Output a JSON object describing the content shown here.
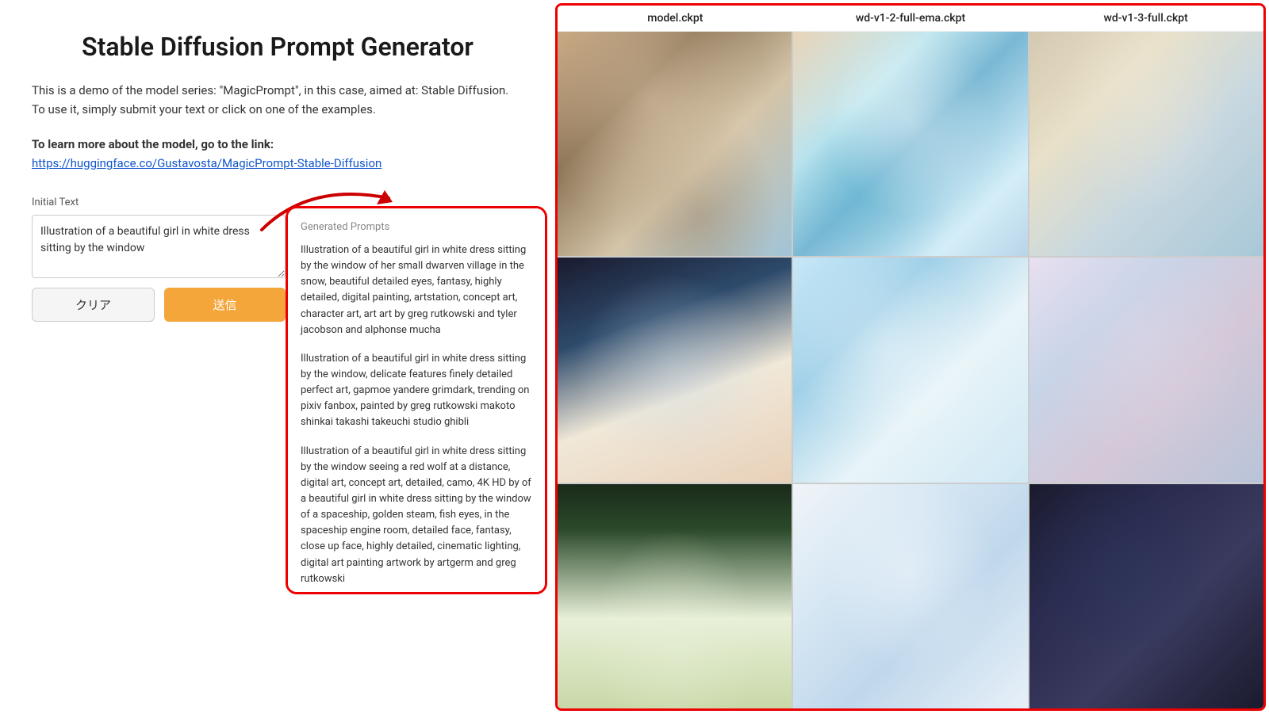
{
  "page": {
    "title": "Stable Diffusion Prompt Generator",
    "description": "This is a demo of the model series: \"MagicPrompt\", in this case, aimed at: Stable Diffusion. To use it, simply submit your text or click on one of the examples.",
    "learn_more_label": "To learn more about the model, go to the link:",
    "learn_more_url": "https://huggingface.co/Gustavosta/MagicPrompt-Stable-Diffusion",
    "learn_more_url_display": "https://huggingface.co/Gustavosta/MagicPrompt-Stable-Diffusion"
  },
  "input_section": {
    "label": "Initial Text",
    "value": "Illustration of a beautiful girl in white dress sitting by the window",
    "placeholder": "Enter text..."
  },
  "buttons": {
    "clear": "クリア",
    "submit": "送信"
  },
  "generated": {
    "label": "Generated Prompts",
    "prompts": [
      "Illustration of a beautiful girl in white dress sitting by the window of her small dwarven village in the snow, beautiful detailed eyes, fantasy, highly detailed, digital painting, artstation, concept art, character art, art art by greg rutkowski and tyler jacobson and alphonse mucha",
      "Illustration of a beautiful girl in white dress sitting by the window, delicate features finely detailed perfect art, gapmoe yandere grimdark, trending on pixiv fanbox, painted by greg rutkowski makoto shinkai takashi takeuchi studio ghibli",
      "Illustration of a beautiful girl in white dress sitting by the window seeing a red wolf at a distance, digital art, concept art, detailed, camo, 4K HD by of a beautiful girl in white dress sitting by the window of a spaceship, golden steam, fish eyes, in the spaceship engine room, detailed face, fantasy, close up face, highly detailed, cinematic lighting, digital art painting artwork by artgerm and greg rutkowski"
    ]
  },
  "model_headers": {
    "col1": "model.ckpt",
    "col2": "wd-v1-2-full-ema.ckpt",
    "col3": "wd-v1-3-full.ckpt"
  },
  "images": [
    {
      "id": 1,
      "class": "img-1"
    },
    {
      "id": 2,
      "class": "img-2"
    },
    {
      "id": 3,
      "class": "img-3"
    },
    {
      "id": 4,
      "class": "img-4"
    },
    {
      "id": 5,
      "class": "img-5"
    },
    {
      "id": 6,
      "class": "img-6"
    },
    {
      "id": 7,
      "class": "img-7"
    },
    {
      "id": 8,
      "class": "img-8"
    },
    {
      "id": 9,
      "class": "img-9"
    }
  ]
}
